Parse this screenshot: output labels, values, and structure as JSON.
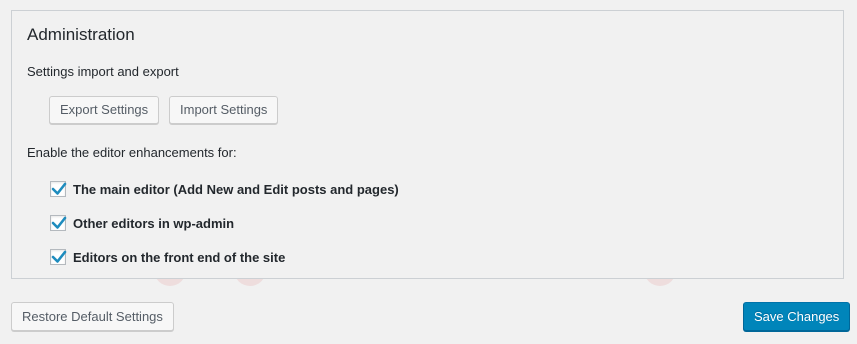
{
  "panel": {
    "title": "Administration",
    "import_export_label": "Settings import and export",
    "export_button": "Export Settings",
    "import_button": "Import Settings",
    "enhancements_label": "Enable the editor enhancements for:",
    "options": [
      {
        "label": "The main editor (Add New and Edit posts and pages)",
        "checked": true
      },
      {
        "label": "Other editors in wp-admin",
        "checked": true
      },
      {
        "label": "Editors on the front end of the site",
        "checked": true
      }
    ]
  },
  "footer": {
    "restore_button": "Restore Default Settings",
    "save_button": "Save Changes"
  },
  "colors": {
    "primary": "#0085ba",
    "checkmark": "#1e8cbe",
    "watermark": "#d63638"
  }
}
